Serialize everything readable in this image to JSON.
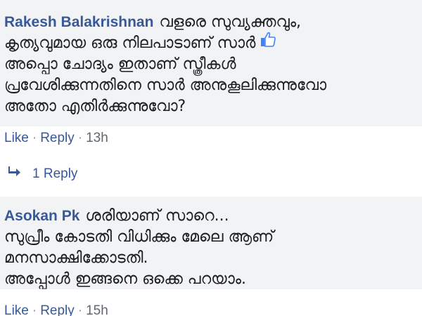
{
  "comments": [
    {
      "author": "Rakesh Balakrishnan",
      "lines": [
        "വളരെ സുവ്യക്തവും,",
        "കൃത്യവുമായ ഒരു നിലപാടാണ് സാർ",
        "അപ്പൊ ചോദ്യം ഇതാണ് സ്ത്രീകൾ",
        "പ്രവേശിക്കുന്നതിനെ സാർ അനുകൂലിക്കുന്നുവോ",
        "അതോ എതിർക്കുന്നുവോ?"
      ],
      "emoji": "thumbs-up-icon",
      "actions": {
        "like": "Like",
        "reply": "Reply",
        "time": "13h"
      },
      "replies_label": "1 Reply"
    },
    {
      "author": "Asokan Pk",
      "lines": [
        "ശരിയാണ് സാറെ...",
        "സുപ്രീം കോടതി വിധിക്കും മേലെ ആണ്",
        "മനസാക്ഷിക്കോടതി.",
        "അപ്പോൾ ഇങ്ങനെ ഒക്കെ പറയാം."
      ],
      "actions": {
        "like": "Like",
        "reply": "Reply",
        "time": "15h"
      }
    }
  ],
  "colors": {
    "bubble": "#f2f3f5",
    "author": "#385898",
    "text": "#1c1e21",
    "meta": "#606770",
    "emoji": "#4080ff"
  }
}
